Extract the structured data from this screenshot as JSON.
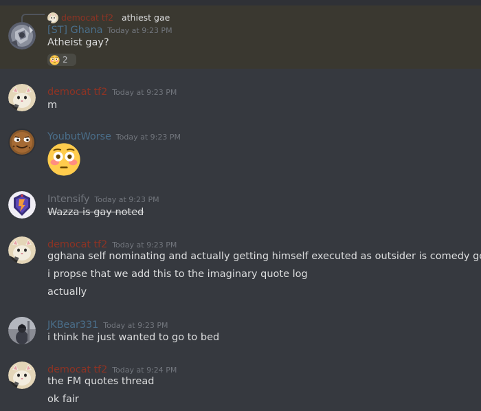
{
  "colors": {
    "background": "#36393f",
    "highlight": "#3a3830",
    "democat": "#8d3324",
    "ghana": "#4a6e8a",
    "youbutworse": "#4a6e8a",
    "intensify": "#72767d",
    "jkbear": "#4a6e8a",
    "text": "#dcddde",
    "timestamp": "#72767d"
  },
  "reply": {
    "author": "democat tf2",
    "text": "athiest gae"
  },
  "messages": [
    {
      "author": "[ST] Ghana",
      "timestamp": "Today at 9:23 PM",
      "lines": [
        "Atheist gay?"
      ],
      "reaction": {
        "emoji": "flushed-face",
        "count": "2"
      }
    },
    {
      "author": "democat tf2",
      "timestamp": "Today at 9:23 PM",
      "lines": [
        "m"
      ]
    },
    {
      "author": "YoubutWorse",
      "timestamp": "Today at 9:23 PM",
      "emoji": "flushed-face"
    },
    {
      "author": "Intensify",
      "timestamp": "Today at 9:23 PM",
      "lines": [
        "Wazza is gay noted"
      ]
    },
    {
      "author": "democat tf2",
      "timestamp": "Today at 9:23 PM",
      "lines": [
        "gghana self nominating and actually getting himself executed as outsider is comedy gold",
        "i propse that we add this to the imaginary quote log",
        "actually"
      ]
    },
    {
      "author": "JKBear331",
      "timestamp": "Today at 9:23 PM",
      "lines": [
        "i think he just wanted to go to bed"
      ]
    },
    {
      "author": "democat tf2",
      "timestamp": "Today at 9:24 PM",
      "lines": [
        "the FM quotes thread",
        "ok fair"
      ]
    }
  ]
}
